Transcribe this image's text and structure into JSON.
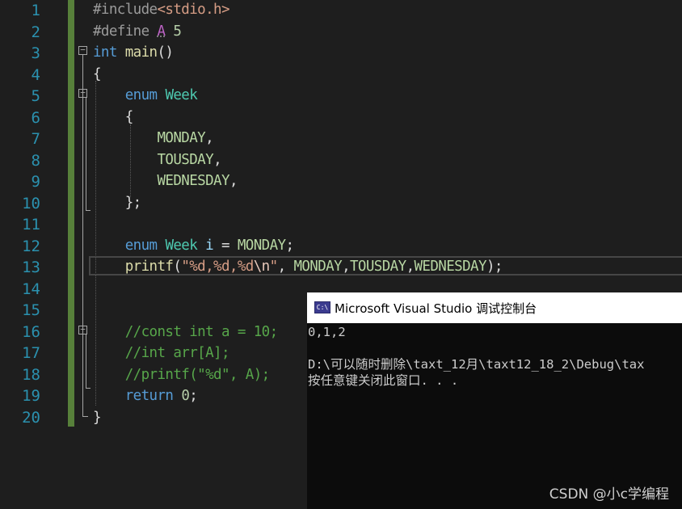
{
  "editor": {
    "line_numbers": [
      "1",
      "2",
      "3",
      "4",
      "5",
      "6",
      "7",
      "8",
      "9",
      "10",
      "11",
      "12",
      "13",
      "14",
      "15",
      "16",
      "17",
      "18",
      "19",
      "20"
    ],
    "lines": {
      "l1": {
        "directive": "#include",
        "header": "<stdio.h>"
      },
      "l2": {
        "directive": "#define",
        "name": "A",
        "value": "5"
      },
      "l3": {
        "type": "int",
        "func": "main",
        "paren": "()"
      },
      "l4": {
        "brace": "{"
      },
      "l5": {
        "kw": "enum",
        "name": "Week"
      },
      "l6": {
        "brace": "{"
      },
      "l7": {
        "enumerator": "MONDAY",
        "punct": ","
      },
      "l8": {
        "enumerator": "TOUSDAY",
        "punct": ","
      },
      "l9": {
        "enumerator": "WEDNESDAY",
        "punct": ","
      },
      "l10": {
        "close": "};"
      },
      "l12": {
        "kw": "enum",
        "type": "Week",
        "var": "i",
        "op": " = ",
        "value": "MONDAY",
        "semi": ";"
      },
      "l13": {
        "func": "printf",
        "open": "(",
        "str_a": "\"%d,%d,%d",
        "esc": "\\n",
        "str_b": "\"",
        "sep": ", ",
        "arg1": "MONDAY",
        "c1": ",",
        "arg2": "TOUSDAY",
        "c2": ",",
        "arg3": "WEDNESDAY",
        "close": ");"
      },
      "l16": {
        "comment": "//const int a = 10;"
      },
      "l17": {
        "comment": "//int arr[A];"
      },
      "l18": {
        "comment": "//printf(\"%d\", A);"
      },
      "l19": {
        "kw": "return",
        "value": "0",
        "semi": ";"
      },
      "l20": {
        "brace": "}"
      }
    }
  },
  "console": {
    "title": "Microsoft Visual Studio 调试控制台",
    "icon": "console-app-icon",
    "icon_glyph": "C:\\",
    "output_line": "0,1,2",
    "path_line": "D:\\可以随时删除\\taxt_12月\\taxt12_18_2\\Debug\\tax",
    "prompt_line": "按任意键关闭此窗口. . ."
  },
  "watermark": "CSDN @小c学编程",
  "colors": {
    "background": "#1e1e1e",
    "line_number": "#2b91af",
    "keyword": "#569cd6",
    "function": "#dcdcaa",
    "type": "#4ec9b0",
    "enum_member": "#b8d7a3",
    "string": "#d69d85",
    "comment": "#57a64a",
    "number": "#b5cea8",
    "change_bar": "#57803a",
    "console_bg": "#0c0c0c"
  }
}
